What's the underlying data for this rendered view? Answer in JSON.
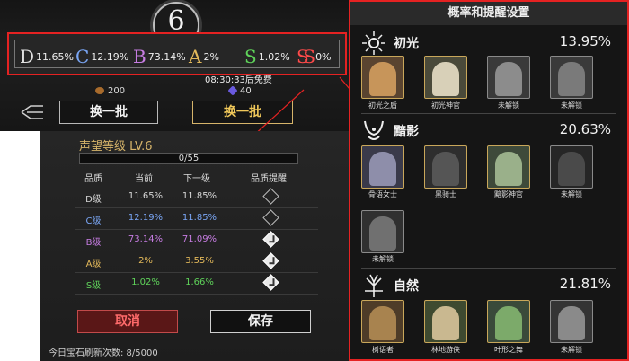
{
  "banner": {
    "level_number": "6",
    "rates": [
      {
        "grade": "D",
        "value": "11.65%",
        "color": "#e0e0e0"
      },
      {
        "grade": "C",
        "value": "12.19%",
        "color": "#7aa6f5"
      },
      {
        "grade": "B",
        "value": "73.14%",
        "color": "#c77de3"
      },
      {
        "grade": "A",
        "value": "2%",
        "color": "#e2b85a"
      },
      {
        "grade": "S",
        "value": "1.02%",
        "color": "#5fd35a"
      },
      {
        "grade": "SS",
        "value": "0%",
        "color": "#ff4a4a"
      }
    ],
    "free_timer": "08:30:33后免费",
    "cost_left": "200",
    "cost_right": "40",
    "refresh_btn_left": "换一批",
    "refresh_btn_right": "换一批"
  },
  "panel": {
    "title": "概率和提醒设置",
    "sections": [
      {
        "name": "初光",
        "percent": "13.95%",
        "cards": [
          "初光之盾",
          "初光神官",
          "未解锁",
          "未解锁"
        ]
      },
      {
        "name": "黯影",
        "percent": "20.63%",
        "cards": [
          "骨语女士",
          "黑骑士",
          "黯影神官",
          "未解锁",
          "未解锁"
        ]
      },
      {
        "name": "自然",
        "percent": "21.81%",
        "cards": [
          "树语者",
          "林地游侠",
          "叶形之舞",
          "未解锁"
        ]
      }
    ]
  },
  "dialog": {
    "level_title": "声望等级 LV.6",
    "progress_text": "0/55",
    "progress_fraction": 0,
    "headers": [
      "品质",
      "当前",
      "下一级",
      "品质提醒"
    ],
    "rows": [
      {
        "grade": "D级",
        "current": "11.65%",
        "next": "11.85%",
        "reminder": false,
        "color": "#d8d8d8"
      },
      {
        "grade": "C级",
        "current": "12.19%",
        "next": "11.85%",
        "reminder": false,
        "color": "#7aa6f5"
      },
      {
        "grade": "B级",
        "current": "73.14%",
        "next": "71.09%",
        "reminder": true,
        "color": "#c77de3"
      },
      {
        "grade": "A级",
        "current": "2%",
        "next": "3.55%",
        "reminder": true,
        "color": "#e2b85a"
      },
      {
        "grade": "S级",
        "current": "1.02%",
        "next": "1.66%",
        "reminder": true,
        "color": "#5fd35a"
      }
    ],
    "cancel_label": "取消",
    "save_label": "保存",
    "refresh_count": "今日宝石刷新次数: 8/5000"
  },
  "colors": {
    "highlight_box": "#e52222",
    "gold": "#d6b46a"
  }
}
